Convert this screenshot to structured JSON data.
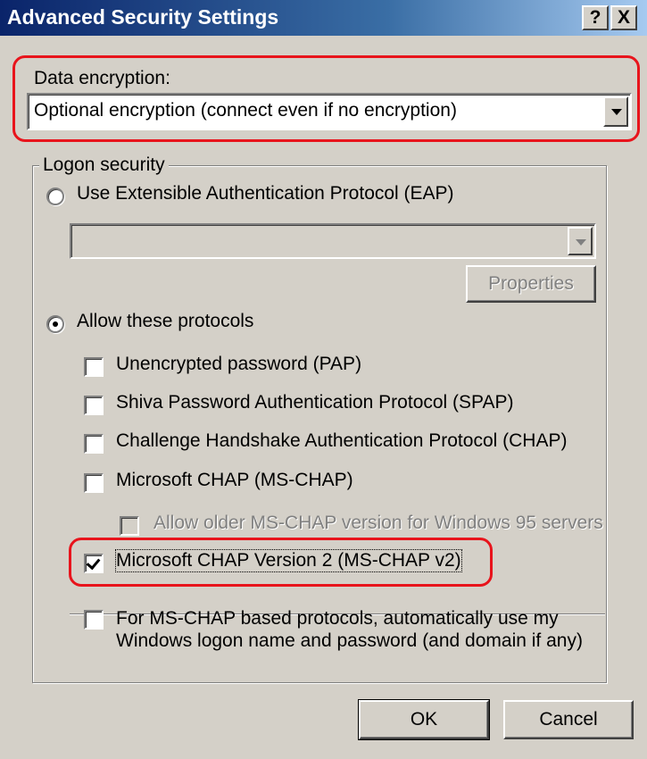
{
  "window": {
    "title": "Advanced Security Settings",
    "help_button": "?",
    "close_button": "X"
  },
  "encryption": {
    "label": "Data encryption:",
    "selected": "Optional encryption (connect even if no encryption)"
  },
  "logon": {
    "group_label": "Logon security",
    "eap_radio": {
      "label": "Use Extensible Authentication Protocol (EAP)",
      "checked": false
    },
    "eap_combo_value": "",
    "properties_button": "Properties",
    "protocols_radio": {
      "label": "Allow these protocols",
      "checked": true
    },
    "protocols": [
      {
        "label": "Unencrypted password (PAP)",
        "checked": false,
        "enabled": true
      },
      {
        "label": "Shiva Password Authentication Protocol (SPAP)",
        "checked": false,
        "enabled": true
      },
      {
        "label": "Challenge Handshake Authentication Protocol (CHAP)",
        "checked": false,
        "enabled": true
      },
      {
        "label": "Microsoft CHAP (MS-CHAP)",
        "checked": false,
        "enabled": true
      },
      {
        "label": "Allow older MS-CHAP version for Windows 95 servers",
        "checked": false,
        "enabled": false
      },
      {
        "label": "Microsoft CHAP Version 2 (MS-CHAP v2)",
        "checked": true,
        "enabled": true
      }
    ],
    "auto_logon": {
      "line1": "For MS-CHAP based protocols, automatically use my",
      "line2": "Windows logon name and password (and domain if any)",
      "checked": false
    }
  },
  "buttons": {
    "ok": "OK",
    "cancel": "Cancel"
  },
  "colors": {
    "titlebar_start": "#0a246a",
    "titlebar_end": "#a6caf0",
    "annotation_red": "#e8141c",
    "face": "#d4d0c8"
  }
}
